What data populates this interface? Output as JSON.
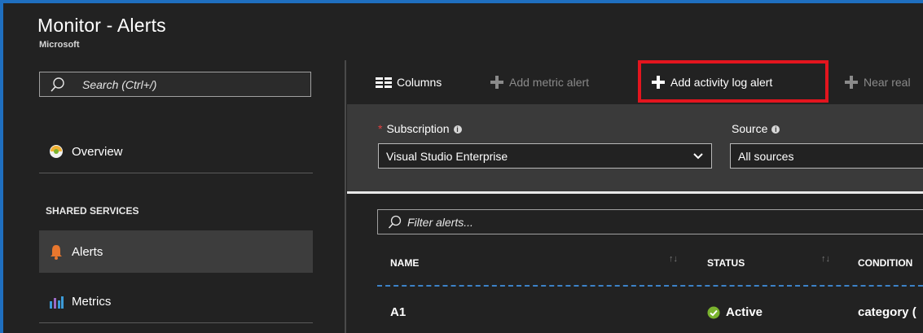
{
  "header": {
    "title": "Monitor - Alerts",
    "subtitle": "Microsoft"
  },
  "sidebar": {
    "search_placeholder": "Search (Ctrl+/)",
    "overview_label": "Overview",
    "section_header": "SHARED SERVICES",
    "items": [
      {
        "label": "Alerts",
        "icon": "bell-icon",
        "active": true
      },
      {
        "label": "Metrics",
        "icon": "metrics-icon",
        "active": false
      }
    ]
  },
  "toolbar": {
    "columns_label": "Columns",
    "add_metric_alert_label": "Add metric alert",
    "add_activity_log_alert_label": "Add activity log alert",
    "near_real_label": "Near real"
  },
  "filters": {
    "subscription_label": "Subscription",
    "subscription_value": "Visual Studio Enterprise",
    "source_label": "Source",
    "source_value": "All sources"
  },
  "list": {
    "filter_placeholder": "Filter alerts...",
    "columns": [
      "NAME",
      "STATUS",
      "CONDITION"
    ],
    "rows": [
      {
        "name": "A1",
        "status": "Active",
        "condition": "category ("
      }
    ]
  },
  "colors": {
    "accent_blue": "#1f6fc0",
    "highlight_red": "#e3151e",
    "active_green": "#7ab32e",
    "alert_orange": "#e8772e"
  }
}
